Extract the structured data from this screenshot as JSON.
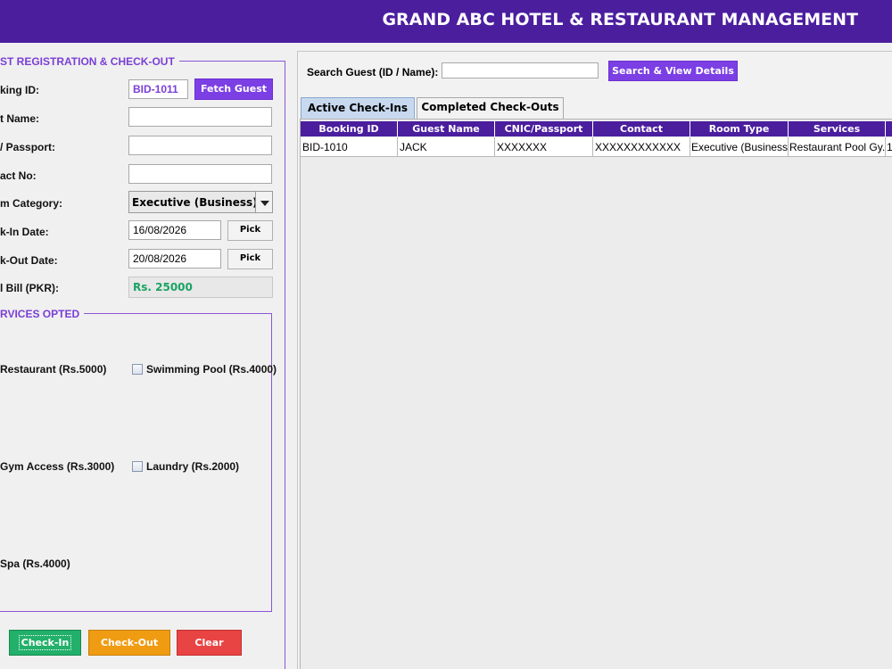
{
  "header": {
    "title": "GRAND ABC HOTEL & RESTAURANT MANAGEMENT"
  },
  "registration": {
    "group_title": "ST REGISTRATION & CHECK-OUT",
    "labels": {
      "booking_id": "king ID:",
      "guest_name": "t Name:",
      "cnic": "/ Passport:",
      "contact": "act No:",
      "room_category": "m Category:",
      "checkin_date": "k-In Date:",
      "checkout_date": "k-Out Date:",
      "total_bill": "l Bill (PKR):"
    },
    "booking_id_value": "BID-1011",
    "fetch_label": "Fetch Guest",
    "guest_name_value": "",
    "cnic_value": "",
    "contact_value": "",
    "room_category_value": "Executive (Business)",
    "checkin_value": "16/08/2026",
    "checkout_value": "20/08/2026",
    "pick_label": "Pick",
    "total_bill_value": "Rs. 25000"
  },
  "services": {
    "group_title": "RVICES OPTED",
    "restaurant": "Restaurant (Rs.5000)",
    "pool": "Swimming Pool (Rs.4000)",
    "gym": "Gym Access (Rs.3000)",
    "laundry": "Laundry (Rs.2000)",
    "spa": "Spa (Rs.4000)"
  },
  "actions": {
    "checkin": "Check-In",
    "checkout": "Check-Out",
    "clear": "Clear"
  },
  "search": {
    "label": "Search Guest (ID / Name):",
    "value": "",
    "button": "Search & View Details"
  },
  "tabs": [
    {
      "label": "Active Check-Ins"
    },
    {
      "label": "Completed Check-Outs"
    }
  ],
  "table": {
    "columns": [
      "Booking ID",
      "Guest Name",
      "CNIC/Passport",
      "Contact",
      "Room Type",
      "Services",
      ""
    ],
    "rows": [
      [
        "BID-1010",
        "JACK",
        "XXXXXXX",
        "XXXXXXXXXXXX",
        "Executive (Business)",
        "Restaurant Pool Gy...",
        "1"
      ]
    ]
  },
  "colors": {
    "header": "#4b1e9e",
    "accent": "#7b3fe4",
    "green": "#22b06a",
    "orange": "#f09c12",
    "red": "#e84444"
  }
}
